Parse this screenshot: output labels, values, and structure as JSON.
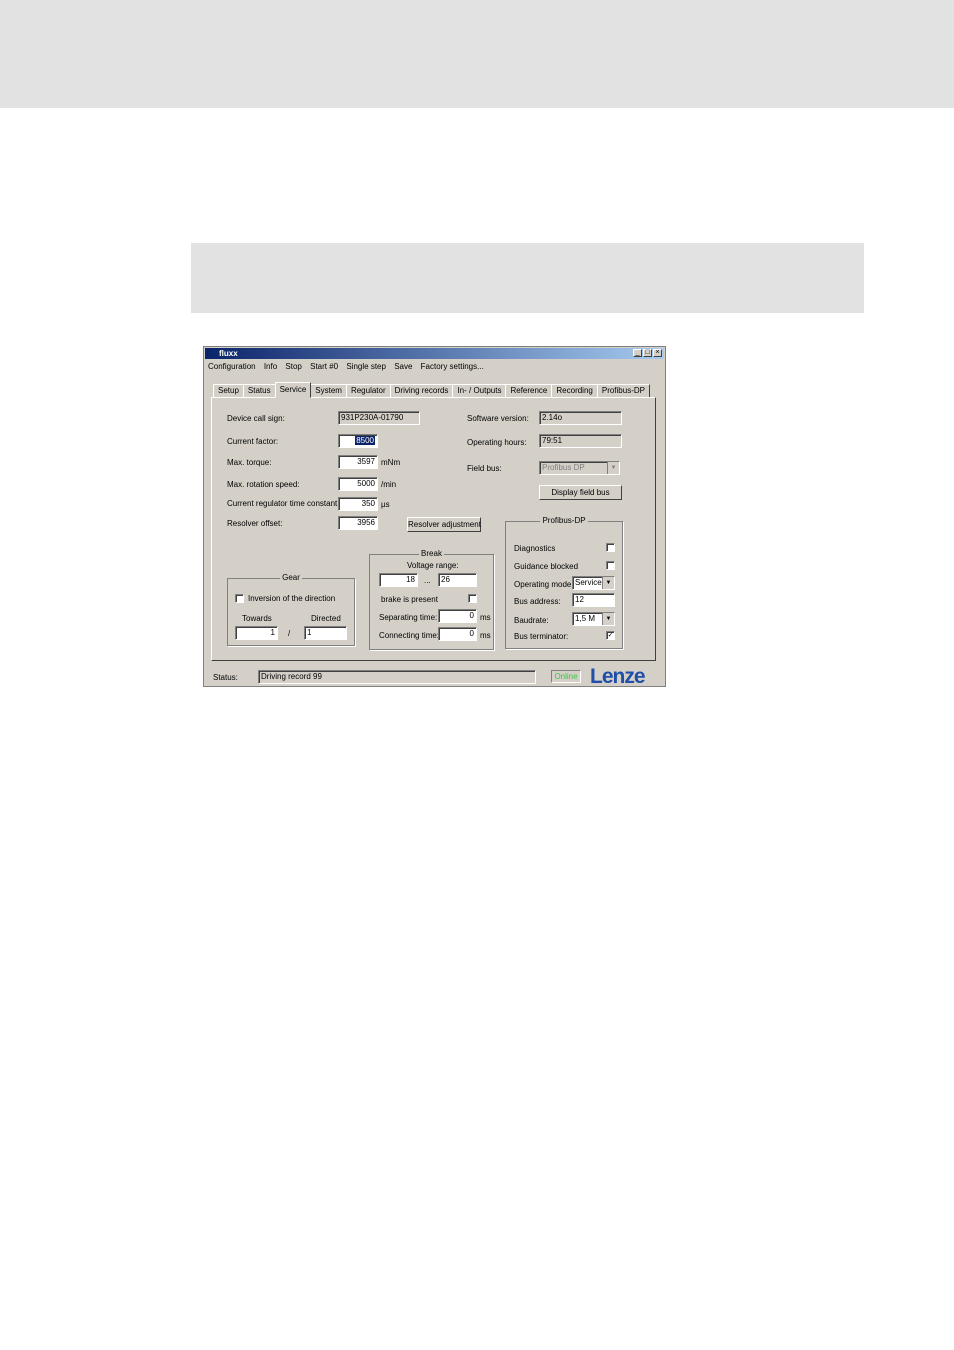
{
  "window": {
    "title": "fluxx",
    "controls": {
      "minimize": "_",
      "maximize": "□",
      "close": "×"
    }
  },
  "menu": [
    "Configuration",
    "Info",
    "Stop",
    "Start #0",
    "Single step",
    "Save",
    "Factory settings..."
  ],
  "tabs": [
    "Setup",
    "Status",
    "Service",
    "System",
    "Regulator",
    "Driving records",
    "In- / Outputs",
    "Reference",
    "Recording",
    "Profibus-DP"
  ],
  "active_tab": "Service",
  "service": {
    "device_call_sign": {
      "label": "Device call sign:",
      "value": "931P230A-01790"
    },
    "current_factor": {
      "label": "Current factor:",
      "value": "8500"
    },
    "max_torque": {
      "label": "Max. torque:",
      "value": "3597",
      "unit": "mNm"
    },
    "max_rotation_speed": {
      "label": "Max. rotation speed:",
      "value": "5000",
      "unit": "/min"
    },
    "current_regulator_time_constant": {
      "label": "Current regulator time constant:",
      "value": "350",
      "unit": "µs"
    },
    "resolver_offset": {
      "label": "Resolver offset:",
      "value": "3956"
    },
    "resolver_adjustment_button": "Resolver adjustment",
    "software_version": {
      "label": "Software version:",
      "value": "2.14o"
    },
    "operating_hours": {
      "label": "Operating hours:",
      "value": "79:51"
    },
    "field_bus": {
      "label": "Field bus:",
      "value": "Profibus DP"
    },
    "display_field_bus_button": "Display field bus"
  },
  "gear": {
    "title": "Gear",
    "inversion_label": "Inversion of the direction",
    "inversion_checked": false,
    "towards_label": "Towards",
    "directed_label": "Directed",
    "towards_value": "1",
    "separator": "/",
    "directed_value": "1"
  },
  "brake": {
    "title": "Break",
    "voltage_range_label": "Voltage range:",
    "voltage_min": "18",
    "range_separator": "...",
    "voltage_max": "26",
    "brake_present_label": "brake is present",
    "brake_present_checked": false,
    "separating_time_label": "Separating time:",
    "separating_time_value": "0",
    "connecting_time_label": "Connecting time:",
    "connecting_time_value": "0",
    "time_unit": "ms"
  },
  "profibus": {
    "title": "Profibus-DP",
    "diagnostics_label": "Diagnostics",
    "diagnostics_checked": false,
    "guidance_blocked_label": "Guidance blocked",
    "guidance_blocked_checked": false,
    "operating_mode_label": "Operating mode:",
    "operating_mode_value": "Service",
    "bus_address_label": "Bus address:",
    "bus_address_value": "12",
    "baudrate_label": "Baudrate:",
    "baudrate_value": "1,5 M",
    "bus_terminator_label": "Bus terminator:",
    "bus_terminator_checked": true
  },
  "status_bar": {
    "label": "Status:",
    "value": "Driving record 99",
    "online": "Online",
    "logo": "Lenze"
  },
  "colors": {
    "title_start": "#0a246a",
    "title_end": "#a6caf0",
    "online_green": "#3cc83c",
    "logo_blue": "#1f4fa8",
    "band_grey": "#e2e2e2"
  }
}
